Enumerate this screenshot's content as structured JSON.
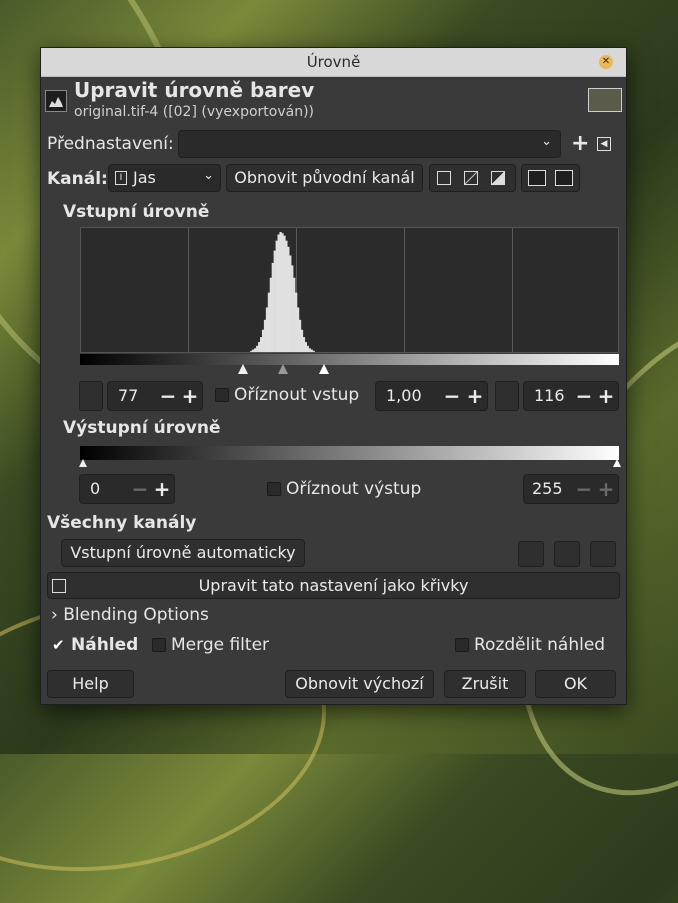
{
  "dialog": {
    "title": "Úrovně",
    "heading": "Upravit úrovně barev",
    "subheading": "original.tif-4 ([02] (vyexportován))"
  },
  "presets": {
    "label": "Přednastavení:",
    "value": ""
  },
  "channel": {
    "label": "Kanál:",
    "value": "Jas",
    "reset_label": "Obnovit původní kanál"
  },
  "input_levels": {
    "heading": "Vstupní úrovně",
    "low": "77",
    "gamma": "1,00",
    "high": "116",
    "clip_label": "Oříznout vstup"
  },
  "output_levels": {
    "heading": "Výstupní úrovně",
    "low": "0",
    "high": "255",
    "clip_label": "Oříznout výstup"
  },
  "all_channels": {
    "heading": "Všechny kanály",
    "auto_label": "Vstupní úrovně automaticky",
    "curves_label": "Upravit tato nastavení jako křivky"
  },
  "blending": {
    "label": "Blending Options"
  },
  "preview": {
    "label": "Náhled",
    "checked": true,
    "merge_label": "Merge filter",
    "split_label": "Rozdělit náhled"
  },
  "buttons": {
    "help": "Help",
    "reset": "Obnovit výchozí",
    "cancel": "Zrušit",
    "ok": "OK"
  },
  "histogram": {
    "bins": [
      0,
      0,
      0,
      0,
      0,
      0,
      0,
      0,
      0,
      0,
      0,
      0,
      0,
      0,
      0,
      0,
      0,
      0,
      0,
      0,
      0,
      0,
      0,
      0,
      0,
      0,
      0,
      0,
      0,
      0,
      0,
      0,
      0,
      0,
      0,
      0,
      0,
      0,
      0,
      0,
      0,
      0,
      0,
      0,
      0,
      0,
      0,
      0,
      0,
      0,
      0,
      0,
      0,
      0,
      0,
      0,
      0,
      0,
      0,
      0,
      0,
      0,
      0,
      0,
      0,
      0,
      0,
      0,
      0,
      0,
      0,
      0,
      0,
      0,
      0,
      0,
      0,
      0,
      0,
      0,
      0,
      0,
      0,
      0,
      0,
      0,
      0,
      1,
      2,
      3,
      5,
      8,
      12,
      18,
      26,
      36,
      48,
      60,
      72,
      82,
      90,
      95,
      97,
      96,
      94,
      90,
      85,
      78,
      70,
      60,
      48,
      36,
      26,
      18,
      12,
      8,
      5,
      3,
      2,
      1,
      0,
      0,
      0,
      0,
      0,
      0,
      0,
      0,
      0,
      0,
      0,
      0,
      0,
      0,
      0,
      0,
      0,
      0,
      0,
      0,
      0,
      0,
      0,
      0,
      0,
      0,
      0,
      0,
      0,
      0,
      0,
      0,
      0,
      0,
      0,
      0,
      0,
      0,
      0,
      0,
      0,
      0,
      0,
      0,
      0,
      0,
      0,
      0,
      0,
      0,
      0,
      0,
      0,
      0,
      0,
      0,
      0,
      0,
      0,
      0,
      0,
      0,
      0,
      0,
      0,
      0,
      0,
      0,
      0,
      0,
      0,
      0,
      0,
      0,
      0,
      0,
      0,
      0,
      0,
      0,
      0,
      0,
      0,
      0,
      0,
      0,
      0,
      0,
      0,
      0,
      0,
      0,
      0,
      0,
      0,
      0,
      0,
      0,
      0,
      0,
      0,
      0,
      0,
      0,
      0,
      0,
      0,
      0,
      0,
      0,
      0,
      0,
      0,
      0,
      0,
      0,
      0,
      0,
      0,
      0,
      0,
      0,
      0,
      0,
      0,
      0,
      0,
      0,
      0,
      0,
      0,
      0,
      0,
      0,
      0,
      0,
      0,
      0,
      0,
      0,
      0,
      0,
      0,
      0,
      0,
      0,
      0,
      0,
      0,
      0,
      0,
      0,
      0,
      0,
      0,
      0
    ]
  },
  "colors": {
    "dialog_bg": "#3a3a3a",
    "titlebar": "#d8d8d8",
    "close": "#e8b85a"
  }
}
